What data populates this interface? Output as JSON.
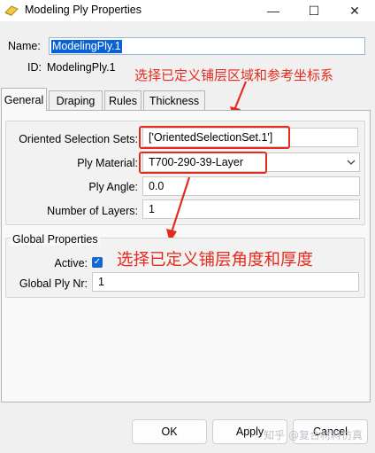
{
  "window": {
    "title": "Modeling Ply Properties",
    "minimize": "—",
    "maximize": "☐",
    "close": "✕"
  },
  "header": {
    "name_label": "Name:",
    "name_value": "ModelingPly.1",
    "id_label": "ID:",
    "id_value": "ModelingPly.1"
  },
  "tabs": [
    {
      "label": "General",
      "active": true
    },
    {
      "label": "Draping",
      "active": false
    },
    {
      "label": "Rules",
      "active": false
    },
    {
      "label": "Thickness",
      "active": false
    }
  ],
  "general": {
    "oriented_sets_label": "Oriented Selection Sets:",
    "oriented_sets_value": "['OrientedSelectionSet.1']",
    "ply_material_label": "Ply Material:",
    "ply_material_value": "T700-290-39-Layer",
    "ply_angle_label": "Ply Angle:",
    "ply_angle_value": "0.0",
    "num_layers_label": "Number of Layers:",
    "num_layers_value": "1"
  },
  "global_properties": {
    "title": "Global Properties",
    "active_label": "Active:",
    "active_checked": true,
    "global_ply_nr_label": "Global Ply Nr:",
    "global_ply_nr_value": "1"
  },
  "annotations": {
    "top": "选择已定义铺层区域和参考坐标系",
    "middle": "选择已定义铺层角度和厚度"
  },
  "buttons": {
    "ok": "OK",
    "apply": "Apply",
    "cancel": "Cancel"
  },
  "watermark": "知乎 @复合材料仿真",
  "colors": {
    "annotation_red": "#e62b1e",
    "selection_blue": "#0a63d6",
    "checkbox_blue": "#1467d2"
  }
}
